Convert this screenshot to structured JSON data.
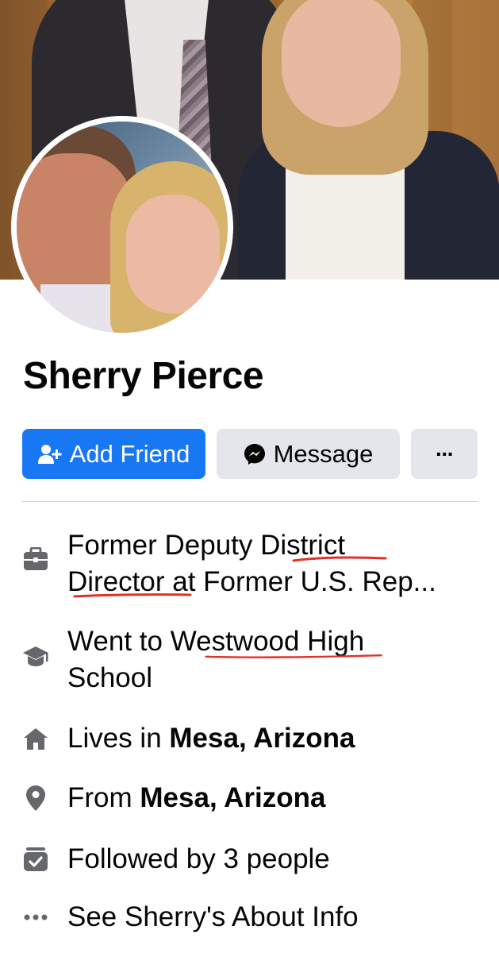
{
  "profile": {
    "name": "Sherry Pierce"
  },
  "actions": {
    "add_friend": "Add Friend",
    "message": "Message",
    "more": "···"
  },
  "intro": {
    "work_line1": "Former Deputy District",
    "work_line2": "Director at Former U.S. Rep...",
    "edu_line1": "Went to Westwood High",
    "edu_line2": "School",
    "lives_prefix": "Lives in",
    "lives_place": "Mesa, Arizona",
    "from_prefix": "From",
    "from_place": "Mesa, Arizona",
    "followers": "Followed by 3 people",
    "about": "See Sherry's About Info"
  },
  "colors": {
    "primary": "#1877f2",
    "secondary_button": "#e4e6eb",
    "icon_gray": "#65676b",
    "annotation_red": "#e0312b"
  },
  "icons": [
    "add-friend-icon",
    "messenger-icon",
    "more-icon",
    "briefcase-icon",
    "graduation-cap-icon",
    "home-icon",
    "location-pin-icon",
    "followers-icon",
    "ellipsis-icon"
  ]
}
